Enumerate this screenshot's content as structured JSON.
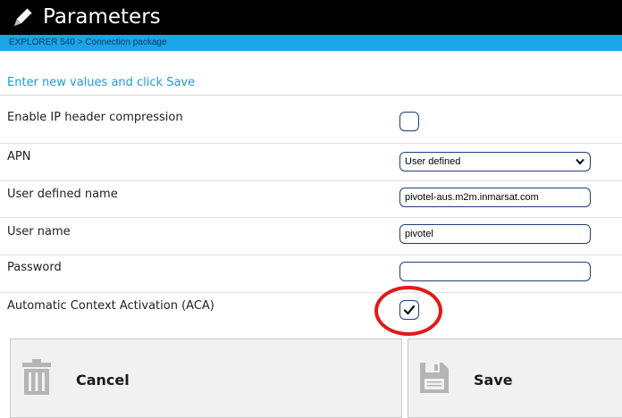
{
  "header": {
    "title": "Parameters",
    "breadcrumb": "EXPLORER 540 > Connection package",
    "title_bar_color": "#000000",
    "breadcrumb_bar_color": "#1aa5e6",
    "icon": "pencil-icon"
  },
  "instruction": "Enter new values and click Save",
  "rows": [
    {
      "label": "Enable IP header compression",
      "type": "checkbox",
      "checked": false
    },
    {
      "label": "APN",
      "type": "select",
      "value": "User defined"
    },
    {
      "label": "User defined name",
      "type": "text",
      "value": "pivotel-aus.m2m.inmarsat.com"
    },
    {
      "label": "User name",
      "type": "text",
      "value": "pivotel"
    },
    {
      "label": "Password",
      "type": "password",
      "value": ""
    },
    {
      "label": "Automatic Context Activation (ACA)",
      "type": "checkbox",
      "checked": true
    }
  ],
  "highlight_color": "#e11919",
  "buttons": {
    "cancel_label": "Cancel",
    "cancel_icon": "trash-icon",
    "save_label": "Save",
    "save_icon": "floppy-disk-icon"
  }
}
